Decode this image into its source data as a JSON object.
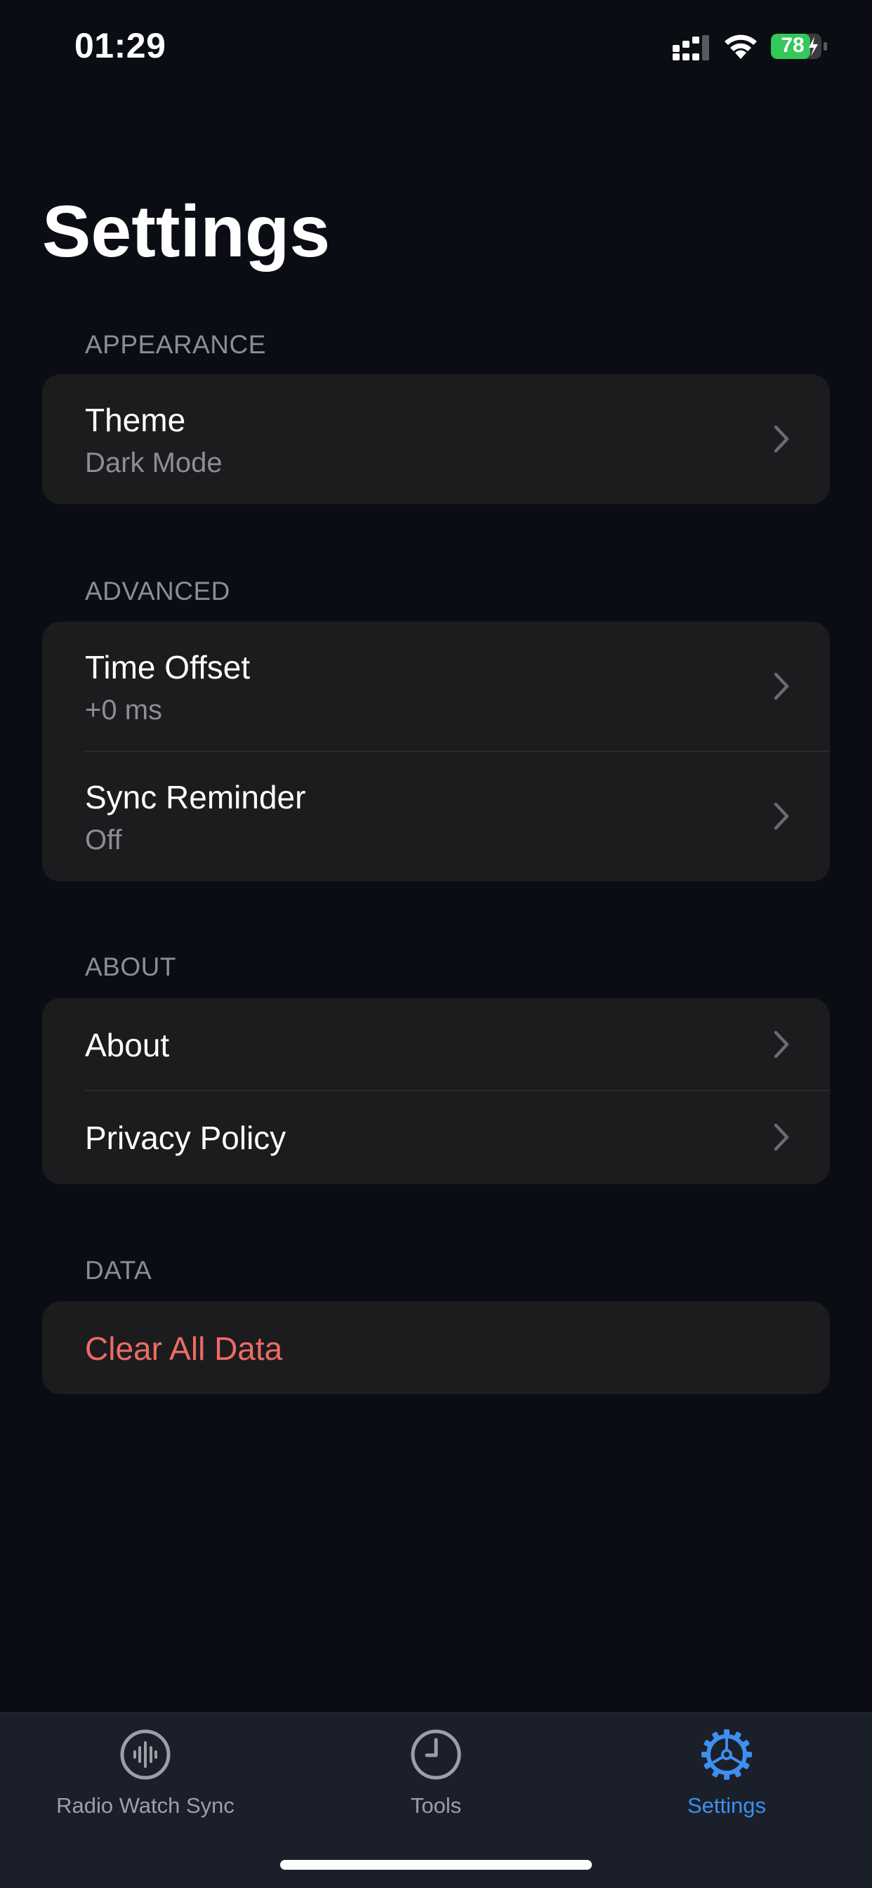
{
  "status_bar": {
    "time": "01:29",
    "battery_level": "78"
  },
  "page": {
    "title": "Settings"
  },
  "sections": {
    "appearance": {
      "header": "APPEARANCE",
      "theme": {
        "title": "Theme",
        "value": "Dark Mode"
      }
    },
    "advanced": {
      "header": "ADVANCED",
      "time_offset": {
        "title": "Time Offset",
        "value": "+0 ms"
      },
      "sync_reminder": {
        "title": "Sync Reminder",
        "value": "Off"
      }
    },
    "about": {
      "header": "ABOUT",
      "about": {
        "title": "About"
      },
      "privacy": {
        "title": "Privacy Policy"
      }
    },
    "data": {
      "header": "DATA",
      "clear": {
        "title": "Clear All Data"
      }
    }
  },
  "tab_bar": {
    "tabs": [
      {
        "label": "Radio Watch Sync",
        "icon": "waveform-icon",
        "active": false
      },
      {
        "label": "Tools",
        "icon": "clock-icon",
        "active": false
      },
      {
        "label": "Settings",
        "icon": "gear-icon",
        "active": true
      }
    ]
  },
  "colors": {
    "background": "#0a0d14",
    "card": "#1c1c1e",
    "accent": "#3d8ff0",
    "danger": "#ee6b65",
    "secondary_text": "#8d8d93",
    "battery_green": "#34c759"
  }
}
